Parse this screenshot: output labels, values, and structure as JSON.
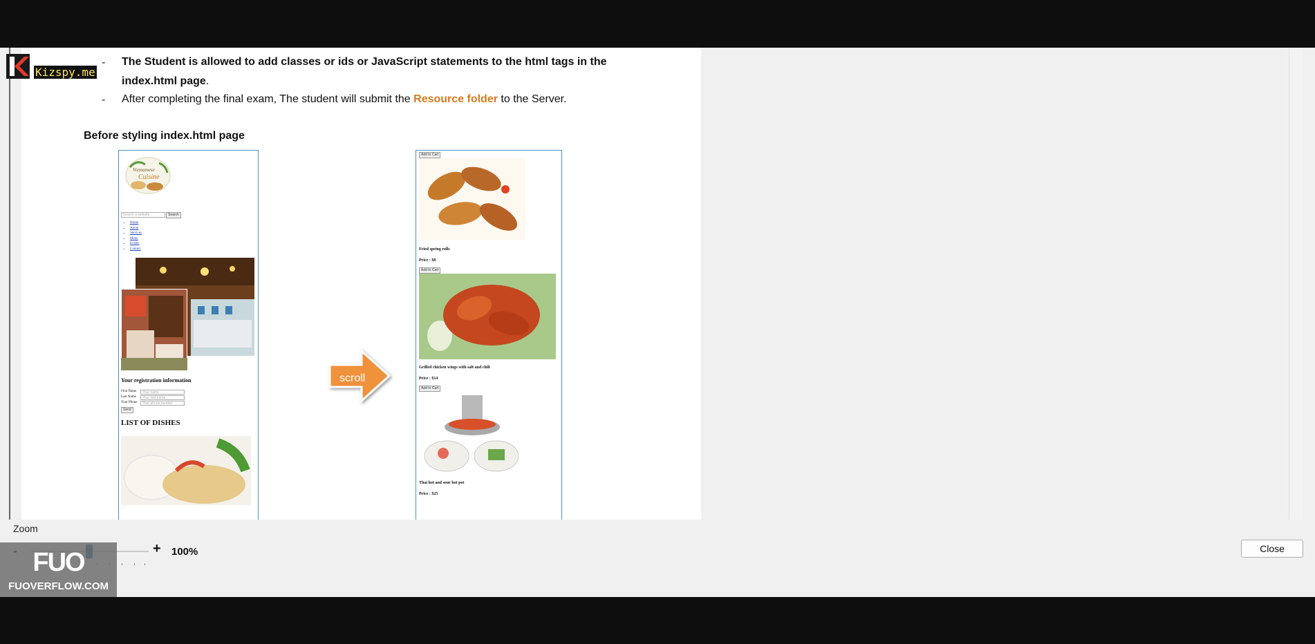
{
  "document": {
    "line1": "The Student is allowed to add classes or ids or JavaScript statements to the html tags in the",
    "line2_bold": "index.html page",
    "line2_rest": ".",
    "line3_pre": "After completing the final exam, The student will submit the ",
    "line3_highlight": "Resource folder",
    "line3_post": " to the Server.",
    "bullet": "-",
    "section_heading": "Before styling index.html page",
    "arrow_label": "scroll"
  },
  "left_screenshot": {
    "logo_text_1": "Vietnamese",
    "logo_text_2": "Cuisine",
    "search_placeholder": "Search a website",
    "search_button": "Search",
    "nav": [
      "Home",
      "About",
      "Services",
      "Menu",
      "Events",
      "Contact"
    ],
    "registration_title": "Your registration information",
    "form_labels": [
      "First Name",
      "Last Name",
      "Your Phone"
    ],
    "form_placeholders": [
      "Your name",
      "Your last name",
      "Your phone number"
    ],
    "send_button": "Send",
    "dishes_title": "LIST OF DISHES"
  },
  "right_screenshot": {
    "add_to_cart": "Add to Cart",
    "dishes": [
      {
        "name": "Fried spring rolls",
        "price": "Price : $8"
      },
      {
        "name": "Grilled chicken wings with salt and chili",
        "price": "Price : $14"
      },
      {
        "name": "Thai hot and sour hot pot",
        "price": "Price : $25"
      }
    ]
  },
  "zoom": {
    "label": "Zoom",
    "minus": "-",
    "plus": "+",
    "value": "100%",
    "level_percent": 100
  },
  "close_label": "Close",
  "watermarks": {
    "kizspy": "Kizspy.me",
    "fuo_logo": "FUO",
    "fuo_site": "FUOVERFLOW.COM"
  },
  "colors": {
    "highlight": "#d97a1e",
    "zoom_thumb": "#0f5aa0",
    "screenshot_border": "#4a8fc4",
    "arrow": "#f0913a"
  }
}
